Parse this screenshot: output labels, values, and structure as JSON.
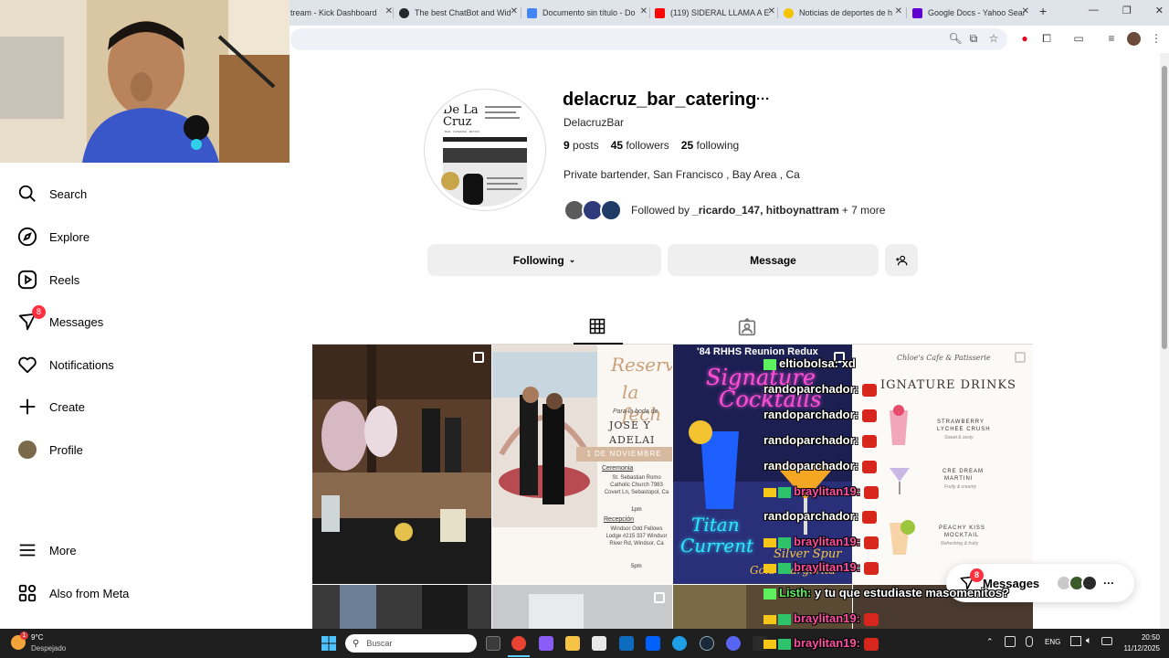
{
  "browser": {
    "tabs": [
      {
        "label": "tream - Kick Dashboard",
        "fav": "kick-icon",
        "color": "#53fc18"
      },
      {
        "label": "The best ChatBot and Wid",
        "fav": "github-icon",
        "color": "#24292f"
      },
      {
        "label": "Documento sin título - Do",
        "fav": "docs-icon",
        "color": "#4285f4"
      },
      {
        "label": "(119) SIDERAL LLAMA A E",
        "fav": "youtube-icon",
        "color": "#ff0000"
      },
      {
        "label": "Noticias de deportes de h",
        "fav": "yahoo-sports-icon",
        "color": "#f5c400"
      },
      {
        "label": "Google Docs - Yahoo Sear",
        "fav": "yahoo-icon",
        "color": "#6001d2"
      }
    ],
    "new_tab": "+"
  },
  "sidebar": {
    "items": [
      {
        "label": "Search",
        "icon": "search-icon"
      },
      {
        "label": "Explore",
        "icon": "compass-icon"
      },
      {
        "label": "Reels",
        "icon": "reels-icon"
      },
      {
        "label": "Messages",
        "icon": "messenger-icon",
        "badge": "8"
      },
      {
        "label": "Notifications",
        "icon": "heart-icon"
      },
      {
        "label": "Create",
        "icon": "plus-icon"
      },
      {
        "label": "Profile",
        "icon": "profile-avatar-icon"
      }
    ],
    "more": "More",
    "meta": "Also from Meta"
  },
  "profile": {
    "username": "delacruz_bar_catering",
    "more": "···",
    "full_name": "DelacruzBar",
    "posts_count": "9",
    "posts_label": "posts",
    "followers_count": "45",
    "followers_label": "followers",
    "following_count": "25",
    "following_label": "following",
    "bio": "Private bartender, San Francisco , Bay Area , Ca",
    "followed_by_prefix": "Followed by ",
    "followed_by_names": "_ricardo_147, hitboynattram",
    "followed_by_more": " + 7 more",
    "avatar_text_main": "De La Cruz",
    "avatar_text_sub": "BAR · CATERING · MIXTAS"
  },
  "actions": {
    "following": "Following",
    "message": "Message"
  },
  "posts": {
    "p2": {
      "title1": "Reserv",
      "title2": "la fech",
      "sub": "Para la boda de",
      "names1": "JOSE Y",
      "names2": "ADELAI",
      "date": "1 DE NOVIEMBRE",
      "ceremonia_label": "Ceremonia",
      "ceremonia_text": "St. Sebastian Romo Catholic Church 7983 Covert Ln, Sebastopol, Ca",
      "time1": "1pm",
      "recepcion_label": "Recepción",
      "recepcion_text": "Windsor Odd Fellows Lodge #215 337 Windsor River Rd, Windsor, Ca",
      "time2": "5pm"
    },
    "p3": {
      "header": "'84 RHHS Reunion Redux",
      "sig1": "Signature",
      "sig2": "Cocktails",
      "titan1": "Titan",
      "titan2": "Current",
      "silver1": "Silver Spur",
      "silver2": "Gold Margarita"
    },
    "p4": {
      "brand": "Chloe's Cafe & Patisserie",
      "heading": "IGNATURE DRINKS",
      "d1": "STRAWBERRY",
      "d1b": "LYCHEE CRUSH",
      "d1c": "Sweet & zesty",
      "d2": "CRE DREAM",
      "d2b": "MARTINI",
      "d2c": "Fruity & creamy",
      "d3": "PEACHY KISS",
      "d3b": "MOCKTAIL",
      "d3c": "Refreshing & fruity"
    }
  },
  "chat": {
    "lines": [
      {
        "user": "eltiobolsa:",
        "msg": " xd"
      },
      {
        "user": "randoparchador:",
        "msg": ""
      },
      {
        "user": "randoparchador:",
        "msg": ""
      },
      {
        "user": "randoparchador:",
        "msg": ""
      },
      {
        "user": "randoparchador:",
        "msg": ""
      },
      {
        "user": "braylitan19:",
        "msg": ""
      },
      {
        "user": "randoparchador:",
        "msg": ""
      },
      {
        "user": "braylitan19:",
        "msg": ""
      },
      {
        "user": "braylitan19:",
        "msg": ""
      },
      {
        "user": "Listh:",
        "msg": " y tu que estudiaste masomenitos?"
      },
      {
        "user": "braylitan19:",
        "msg": ""
      },
      {
        "user": "braylitan19:",
        "msg": ""
      }
    ]
  },
  "messages_widget": {
    "label": "Messages",
    "badge": "8",
    "more": "···"
  },
  "taskbar": {
    "weather_temp": "9°C",
    "weather_desc": "Despejado",
    "weather_badge": "1",
    "search_placeholder": "Buscar",
    "lang": "ENG",
    "time": "20:50",
    "date": "11/12/2025"
  }
}
